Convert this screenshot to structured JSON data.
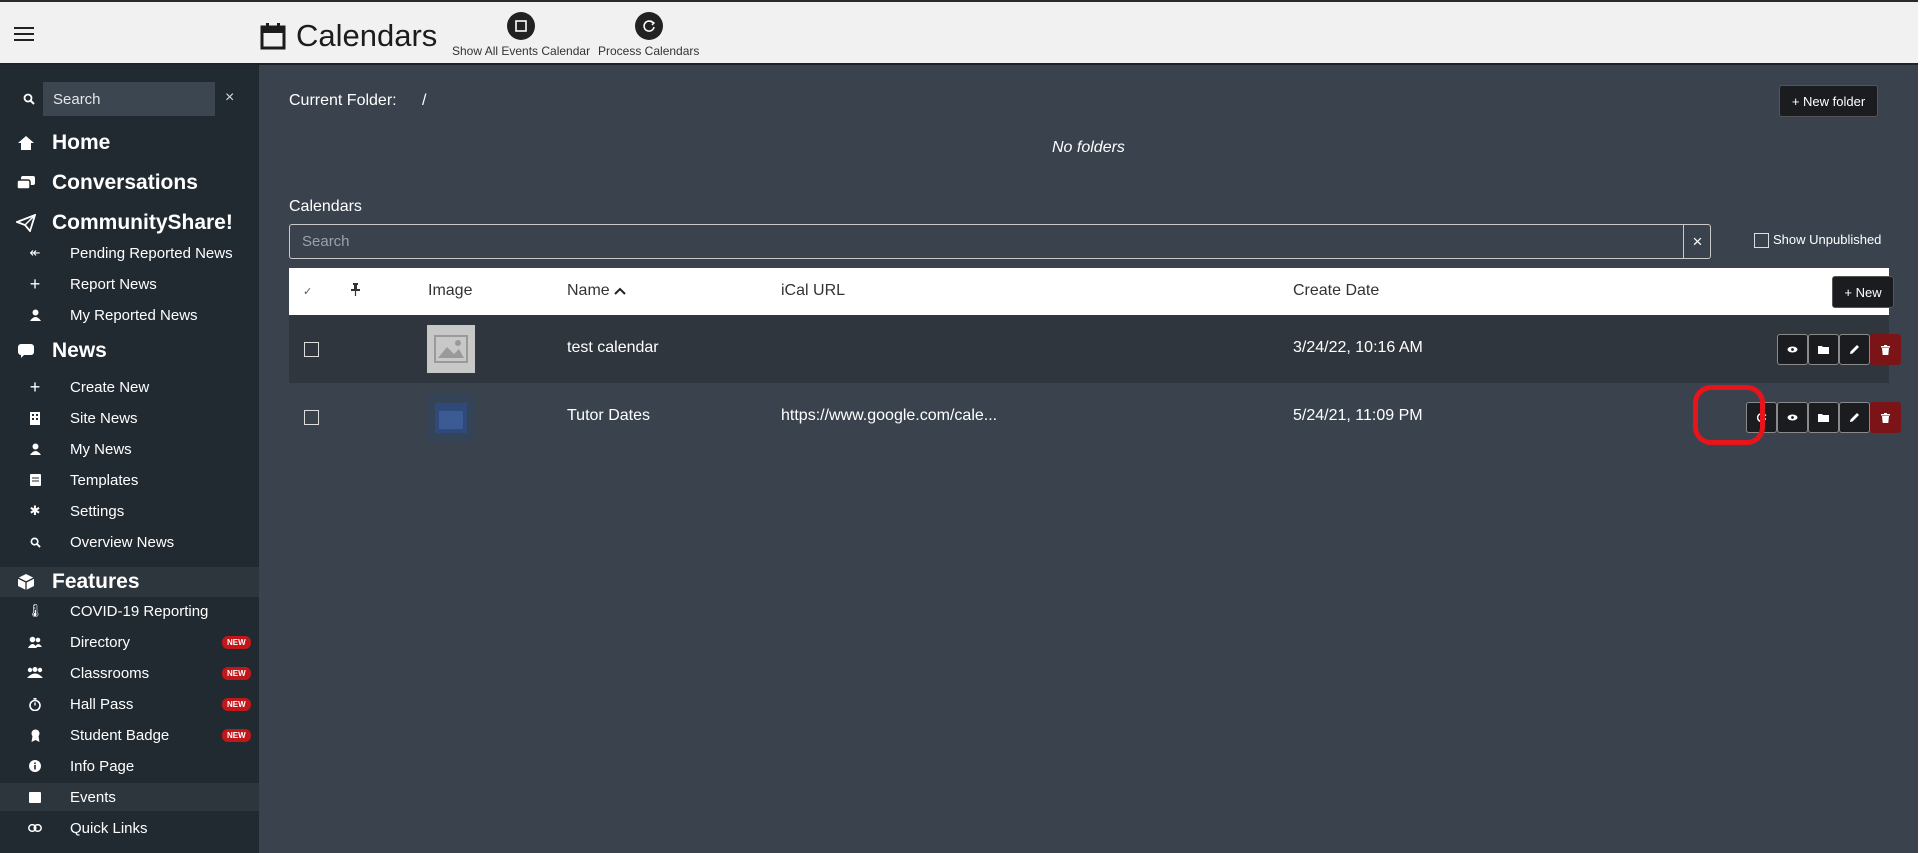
{
  "header": {
    "title": "Calendars",
    "tools": [
      {
        "label": "Show All Events Calendar",
        "icon": "square-icon"
      },
      {
        "label": "Process Calendars",
        "icon": "refresh-icon"
      }
    ]
  },
  "sidebar": {
    "search_placeholder": "Search",
    "close": "×",
    "sections": {
      "home": "Home",
      "conversations": "Conversations",
      "communityshare": "CommunityShare!",
      "news": "News",
      "features": "Features"
    },
    "communityshare_items": [
      "Pending Reported News",
      "Report News",
      "My Reported News"
    ],
    "news_items": [
      "Create New",
      "Site News",
      "My News",
      "Templates",
      "Settings",
      "Overview News"
    ],
    "feature_items": [
      "COVID-19 Reporting",
      "Directory",
      "Classrooms",
      "Hall Pass",
      "Student Badge",
      "Info Page",
      "Events",
      "Quick Links"
    ],
    "badge": "NEW"
  },
  "main": {
    "current_folder_label": "Current Folder:",
    "current_folder_value": "/",
    "new_folder": "+ New folder",
    "no_folders": "No folders",
    "calendars_label": "Calendars",
    "search_placeholder": "Search",
    "clear": "×",
    "show_unpublished": "Show Unpublished",
    "columns": {
      "check": "✓",
      "pin": "📌",
      "image": "Image",
      "name": "Name",
      "ical": "iCal URL",
      "create_date": "Create Date"
    },
    "new_button": "+ New",
    "rows": [
      {
        "name": "test calendar",
        "ical": "",
        "date": "3/24/22, 10:16 AM"
      },
      {
        "name": "Tutor Dates",
        "ical": "https://www.google.com/cale...",
        "date": "5/24/21, 11:09 PM"
      }
    ]
  },
  "colors": {
    "sidebar": "#222a31",
    "main_bg": "#3a434d",
    "danger": "#7a1417",
    "highlight": "#e8141c",
    "badge": "#c0171b"
  }
}
